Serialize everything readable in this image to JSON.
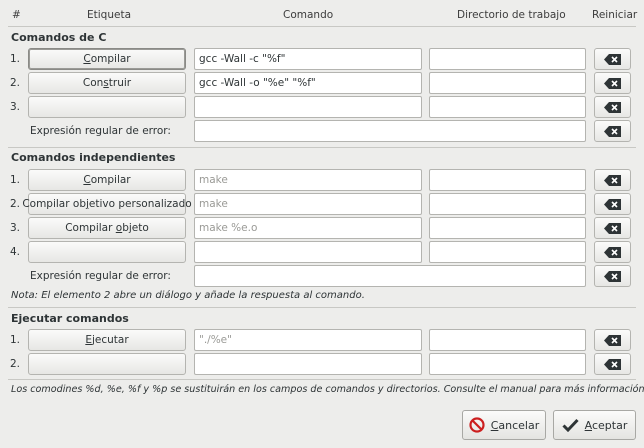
{
  "header": {
    "num": "#",
    "label": "Etiqueta",
    "command": "Comando",
    "workdir": "Directorio de trabajo",
    "reset": "Reiniciar"
  },
  "c_commands": {
    "title": "Comandos de C",
    "rows": [
      {
        "num": "1.",
        "label_pre": "",
        "label_acc": "C",
        "label_post": "ompilar",
        "command": "gcc -Wall -c \"%f\"",
        "workdir": ""
      },
      {
        "num": "2.",
        "label_pre": "Con",
        "label_acc": "s",
        "label_post": "truir",
        "command": "gcc -Wall -o \"%e\" \"%f\"",
        "workdir": ""
      },
      {
        "num": "3.",
        "label_pre": "",
        "label_acc": "",
        "label_post": "",
        "command": "",
        "workdir": ""
      }
    ],
    "regex_label": "Expresión regular de error:",
    "regex_value": ""
  },
  "independent_commands": {
    "title": "Comandos independientes",
    "rows": [
      {
        "num": "1.",
        "label_pre": "",
        "label_acc": "C",
        "label_post": "ompilar",
        "command_placeholder": "make",
        "workdir": ""
      },
      {
        "num": "2.",
        "label_pre": "Compilar ob",
        "label_acc": "j",
        "label_post": "etivo personalizado",
        "command_placeholder": "make",
        "workdir": ""
      },
      {
        "num": "3.",
        "label_pre": "Compilar ",
        "label_acc": "o",
        "label_post": "bjeto",
        "command_placeholder": "make %e.o",
        "workdir": ""
      },
      {
        "num": "4.",
        "label_pre": "",
        "label_acc": "",
        "label_post": "",
        "command_placeholder": "",
        "workdir": ""
      }
    ],
    "regex_label": "Expresión regular de error:",
    "regex_value": "",
    "note": "Nota: El elemento 2 abre un diálogo y añade la respuesta al comando."
  },
  "execute_commands": {
    "title": "Ejecutar comandos",
    "rows": [
      {
        "num": "1.",
        "label_pre": "",
        "label_acc": "E",
        "label_post": "jecutar",
        "command_placeholder": "\"./%e\"",
        "workdir": ""
      },
      {
        "num": "2.",
        "label_pre": "",
        "label_acc": "",
        "label_post": "",
        "command_placeholder": "",
        "workdir": ""
      }
    ]
  },
  "footer_note": "Los comodines %d, %e, %f y %p se sustituirán en los campos de comandos y directorios. Consulte el manual para más información.",
  "buttons": {
    "cancel_acc": "C",
    "cancel_rest": "ancelar",
    "accept_acc": "A",
    "accept_rest": "ceptar"
  },
  "icons": {
    "reset": "clear-backspace-icon",
    "cancel": "cancel-circle-icon",
    "accept": "checkmark-icon"
  },
  "colors": {
    "background": "#ededeb",
    "cancel_icon": "#cc1f1f",
    "entry_bg": "#ffffff",
    "placeholder": "#9a9a96"
  }
}
